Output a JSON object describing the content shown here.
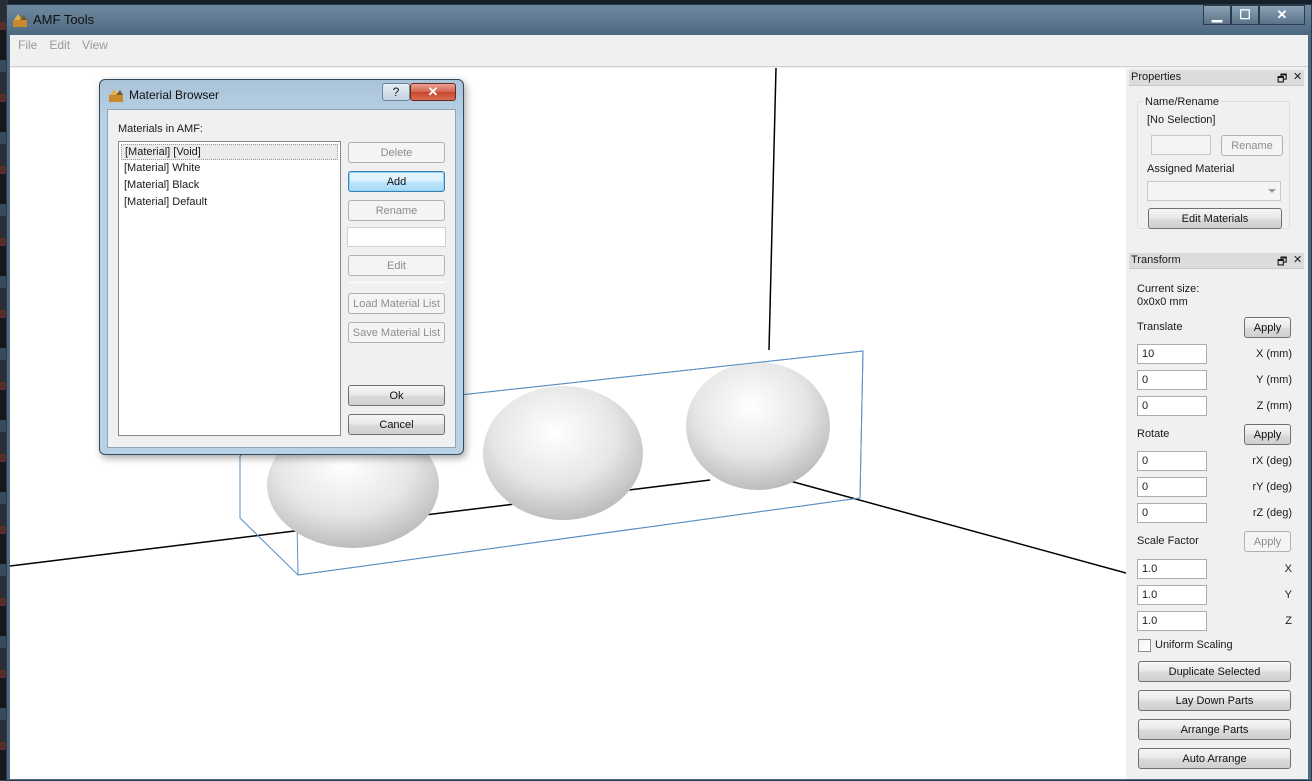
{
  "window": {
    "title": "AMF Tools",
    "minimize_glyph": "▁",
    "maximize_glyph": "☐",
    "close_glyph": "✕"
  },
  "menu": [
    "File",
    "Edit",
    "View"
  ],
  "icons": {
    "app": "amf-tools-icon",
    "help": "help-icon",
    "close": "close-icon",
    "float": "dock-float-icon",
    "dock_close": "dock-close-icon",
    "dropdown": "chevron-down-icon"
  },
  "dialog": {
    "title": "Material Browser",
    "help_glyph": "?",
    "close_glyph": "✕",
    "list_label": "Materials in AMF:",
    "materials": [
      "[Material] [Void]",
      "[Material] White",
      "[Material] Black",
      "[Material] Default"
    ],
    "selected_index": 0,
    "buttons": {
      "delete": "Delete",
      "add": "Add",
      "rename": "Rename",
      "rename_value": "",
      "edit": "Edit",
      "load": "Load Material List",
      "save": "Save Material List",
      "ok": "Ok",
      "cancel": "Cancel"
    }
  },
  "properties": {
    "header": "Properties",
    "float_glyph": "🗗",
    "close_glyph": "✕",
    "name_group": "Name/Rename",
    "selection": "[No Selection]",
    "name_value": "",
    "rename_label": "Rename",
    "assigned_label": "Assigned Material",
    "assigned_value": "",
    "edit_materials": "Edit Materials"
  },
  "transform": {
    "header": "Transform",
    "float_glyph": "🗗",
    "close_glyph": "✕",
    "current_size_label": "Current size:",
    "current_size": "0x0x0 mm",
    "translate_label": "Translate",
    "apply": "Apply",
    "translate": [
      {
        "value": "10",
        "unit": "X (mm)"
      },
      {
        "value": "0",
        "unit": "Y (mm)"
      },
      {
        "value": "0",
        "unit": "Z (mm)"
      }
    ],
    "rotate_label": "Rotate",
    "rotate": [
      {
        "value": "0",
        "unit": "rX (deg)"
      },
      {
        "value": "0",
        "unit": "rY (deg)"
      },
      {
        "value": "0",
        "unit": "rZ (deg)"
      }
    ],
    "scale_label": "Scale Factor",
    "scale": [
      {
        "value": "1.0",
        "unit": "X"
      },
      {
        "value": "1.0",
        "unit": "Y"
      },
      {
        "value": "1.0",
        "unit": "Z"
      }
    ],
    "uniform_scaling": "Uniform Scaling",
    "uniform_checked": false,
    "duplicate": "Duplicate Selected",
    "lay_down": "Lay Down Parts",
    "arrange": "Arrange Parts",
    "auto_arrange": "Auto Arrange"
  },
  "colors": {
    "titlebar": "#5a7590",
    "viewport": "#ffffff",
    "bbox_line": "#5a8fc4",
    "axis_line": "#000000"
  }
}
